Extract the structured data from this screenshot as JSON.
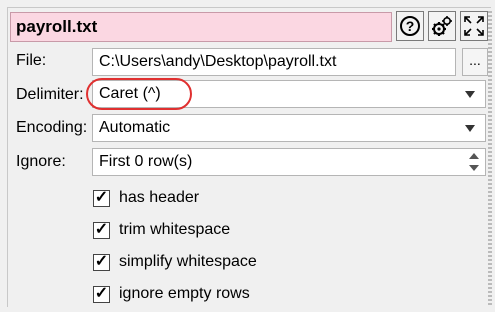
{
  "header": {
    "title_value": "payroll.txt",
    "help_label": "?"
  },
  "icons": {
    "help": "question-mark-icon",
    "settings": "gears-icon",
    "expand": "expand-arrows-icon"
  },
  "file": {
    "label": "File:",
    "value": "C:\\Users\\andy\\Desktop\\payroll.txt",
    "browse_label": "..."
  },
  "delimiter": {
    "label": "Delimiter:",
    "value": "Caret (^)"
  },
  "encoding": {
    "label": "Encoding:",
    "value": "Automatic"
  },
  "ignore": {
    "label": "Ignore:",
    "value": "First 0 row(s)"
  },
  "options": [
    {
      "label": "has header",
      "checked": true
    },
    {
      "label": "trim whitespace",
      "checked": true
    },
    {
      "label": "simplify whitespace",
      "checked": true
    },
    {
      "label": "ignore empty rows",
      "checked": true
    }
  ],
  "colors": {
    "title_bg": "#fbd7e2",
    "highlight": "#e03030"
  }
}
